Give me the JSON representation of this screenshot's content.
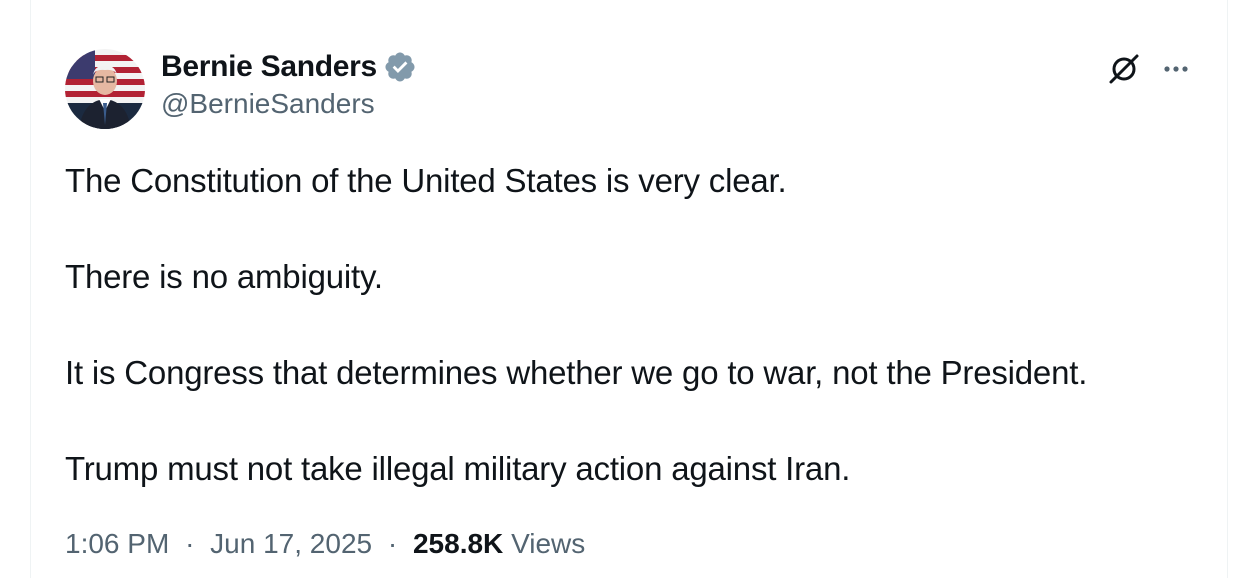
{
  "author": {
    "display_name": "Bernie Sanders",
    "handle": "@BernieSanders",
    "verified": true,
    "verified_color": "#829aab"
  },
  "tweet": {
    "paragraphs": [
      "The Constitution of the United States is very clear.",
      "There is no ambiguity.",
      "It is Congress that determines whether we go to war, not the President.",
      "Trump must not take illegal military action against Iran."
    ]
  },
  "meta": {
    "time": "1:06 PM",
    "separator": "·",
    "date": "Jun 17, 2025",
    "views_count": "258.8K",
    "views_label": "Views"
  },
  "icons": {
    "grok": "grok-icon",
    "more": "more-icon",
    "verified": "verified-badge-icon"
  },
  "colors": {
    "text_primary": "#0f1419",
    "text_secondary": "#536471",
    "border": "#eff3f4"
  }
}
